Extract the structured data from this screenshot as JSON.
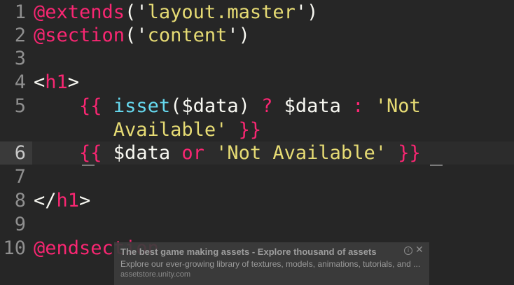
{
  "editor": {
    "lines": [
      {
        "num": "1",
        "parts": [
          [
            "@",
            "c-at"
          ],
          [
            "extends",
            "c-dir"
          ],
          [
            "('",
            "c-punc"
          ],
          [
            "layout.master",
            "c-str"
          ],
          [
            "')",
            "c-punc"
          ]
        ]
      },
      {
        "num": "2",
        "parts": [
          [
            "@",
            "c-at"
          ],
          [
            "section",
            "c-dir"
          ],
          [
            "('",
            "c-punc"
          ],
          [
            "content",
            "c-str"
          ],
          [
            "')",
            "c-punc"
          ]
        ]
      },
      {
        "num": "3",
        "parts": []
      },
      {
        "num": "4",
        "parts": [
          [
            "<",
            "c-punc"
          ],
          [
            "h1",
            "c-tag"
          ],
          [
            ">",
            "c-punc"
          ]
        ]
      },
      {
        "num": "5",
        "parts": [
          [
            "    ",
            "c-text"
          ],
          [
            "{{",
            "c-brace"
          ],
          [
            " ",
            "c-text"
          ],
          [
            "isset",
            "c-func"
          ],
          [
            "($data) ",
            "c-var"
          ],
          [
            "?",
            "c-op"
          ],
          [
            " $data ",
            "c-var"
          ],
          [
            ":",
            "c-op"
          ],
          [
            " ",
            "c-text"
          ],
          [
            "'Not",
            "c-str"
          ]
        ]
      },
      {
        "num": "",
        "parts": [
          [
            "       ",
            "c-text"
          ],
          [
            "Available'",
            "c-str"
          ],
          [
            " ",
            "c-text"
          ],
          [
            "}}",
            "c-brace"
          ]
        ]
      },
      {
        "num": "6",
        "parts": [
          [
            "    ",
            "c-text"
          ],
          [
            "{{",
            "c-brace"
          ],
          [
            " $data ",
            "c-var"
          ],
          [
            "or",
            "c-kw"
          ],
          [
            " ",
            "c-text"
          ],
          [
            "'Not Available'",
            "c-str"
          ],
          [
            " ",
            "c-text"
          ],
          [
            "}}",
            "c-brace"
          ]
        ]
      },
      {
        "num": "7",
        "parts": []
      },
      {
        "num": "8",
        "parts": [
          [
            "</",
            "c-punc"
          ],
          [
            "h1",
            "c-tag"
          ],
          [
            ">",
            "c-punc"
          ]
        ]
      },
      {
        "num": "9",
        "parts": []
      },
      {
        "num": "10",
        "parts": [
          [
            "@",
            "c-at"
          ],
          [
            "endsection",
            "c-dir"
          ]
        ]
      }
    ],
    "active_line": "6"
  },
  "ad": {
    "title": "The best game making assets - Explore thousand of assets",
    "description": "Explore our ever-growing library of textures, models, animations, tutorials, and ...",
    "url": "assetstore.unity.com",
    "info_glyph": "i",
    "close_glyph": "✕"
  }
}
